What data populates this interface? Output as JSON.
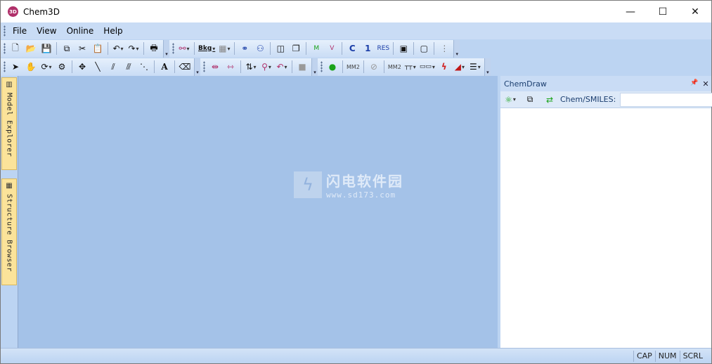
{
  "window": {
    "title": "Chem3D",
    "icon_text": "3D"
  },
  "window_controls": {
    "minimize": "—",
    "maximize": "☐",
    "close": "✕"
  },
  "menu": [
    "File",
    "View",
    "Online",
    "Help"
  ],
  "toolbar1": {
    "new": "🗋",
    "open": "📂",
    "save": "💾",
    "copy": "⧉",
    "cut": "✂",
    "paste": "📋",
    "undo": "↶",
    "redo": "↷",
    "print": "🖶",
    "bond_style": "⚯",
    "bkg": "Bkg",
    "gradient": "▦",
    "stereo1": "⚭",
    "stereo2": "⚇",
    "box1": "◫",
    "box2": "❐",
    "axis_m": "M",
    "axis_v": "V",
    "c_label": "C",
    "one_label": "1",
    "res_label": "RES",
    "monitor1": "▣",
    "monitor2": "▢",
    "more": "⋮"
  },
  "toolbar2": {
    "select": "➤",
    "hand": "✋",
    "rotate": "⟳",
    "trackball": "⚙",
    "move": "✥",
    "single_bond": "╲",
    "double_bond": "⫽",
    "triple_bond": "⫻",
    "dashed_bond": "⋱",
    "text_tool": "A",
    "eraser": "⌫",
    "flip1": "⇹",
    "flip2": "⇿",
    "sort": "⇅",
    "measure1": "⚲",
    "measure2": "↶",
    "stop": "■",
    "dot": "●",
    "mm2_1": "MM2",
    "cancel": "⊘",
    "mm2_2": "MM2",
    "ruler1": "┬┬",
    "ruler2": "▭▭",
    "lightning": "ϟ",
    "ramp": "◢",
    "lines": "☰"
  },
  "left_tabs": [
    {
      "icon": "▥",
      "label": "Model Explorer"
    },
    {
      "icon": "▦",
      "label": "Structure Browser"
    }
  ],
  "watermark": {
    "logo": "ϟ",
    "text_cn": "闪电软件园",
    "url": "www.sd173.com"
  },
  "chemdraw_pane": {
    "title": "ChemDraw",
    "pin": "📌",
    "close": "✕",
    "tool1": "⚛",
    "tool2": "⧉",
    "tool3": "⇄",
    "smiles_label": "Chem/SMILES:",
    "smiles_value": ""
  },
  "status": [
    "CAP",
    "NUM",
    "SCRL"
  ]
}
